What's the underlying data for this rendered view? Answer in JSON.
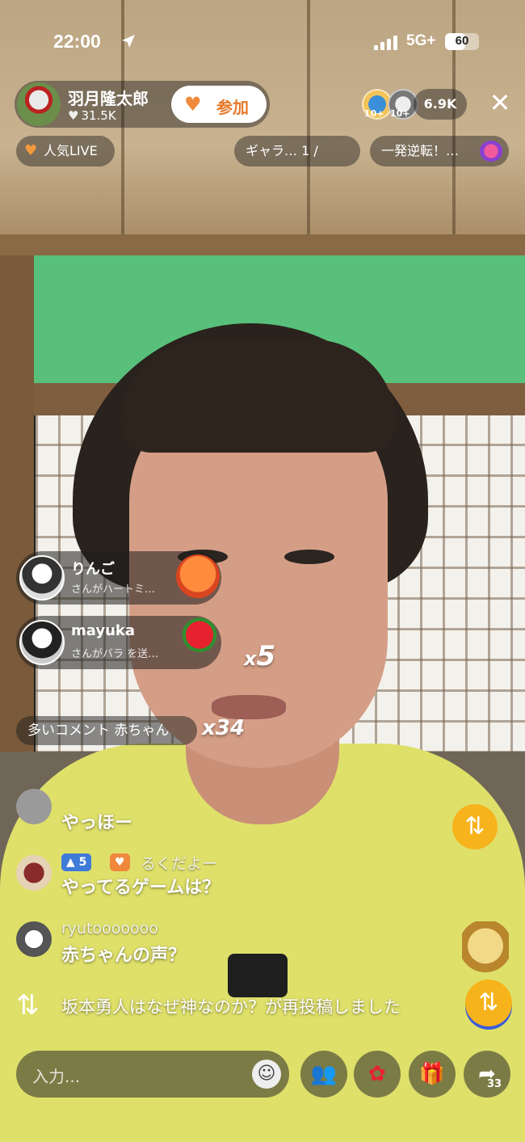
{
  "status": {
    "time": "22:00",
    "network": "5G+",
    "battery": "60",
    "battery_level": 0.6
  },
  "host": {
    "name": "羽月隆太郎",
    "likes": "31.5K",
    "join_label": "参加"
  },
  "viewers": {
    "badge1": "10+",
    "badge2": "10+",
    "count": "6.9K"
  },
  "chips": {
    "popular": "人気LIVE",
    "gallery": "ギャラ… 1 /",
    "comeback": "一発逆転！…"
  },
  "gifts": [
    {
      "name": "りんご",
      "sub": "さんがハートミ…",
      "mult": ""
    },
    {
      "name": "mayuka",
      "sub": "さんがバラ を送…",
      "mult_prefix": "x",
      "mult": "5"
    }
  ],
  "combo": {
    "text": "多いコメント 赤ちゃん",
    "mult": "x34"
  },
  "chat": [
    {
      "name": "",
      "message": "やっほー"
    },
    {
      "name": "るくだよー",
      "level": "5",
      "message": "やってるゲームは？"
    },
    {
      "name": "ryutooooooo",
      "message": "赤ちゃんの声？"
    }
  ],
  "repost": {
    "text": "坂本勇人はなぜ神なのか？が再投稿しました"
  },
  "bottom": {
    "input_placeholder": "入力...",
    "share_count": "33"
  },
  "icons": {
    "location": "location-arrow-icon",
    "signal": "signal-icon",
    "close": "close-icon",
    "heart": "heart-icon",
    "repost": "repost-icon",
    "emoji": "emoji-icon",
    "collab": "collab-icon",
    "rose": "rose-icon",
    "gift": "gift-icon",
    "share": "share-icon"
  },
  "colors": {
    "accent": "#f7b31b",
    "join": "#e6792b",
    "shirt": "#dfe06a"
  }
}
